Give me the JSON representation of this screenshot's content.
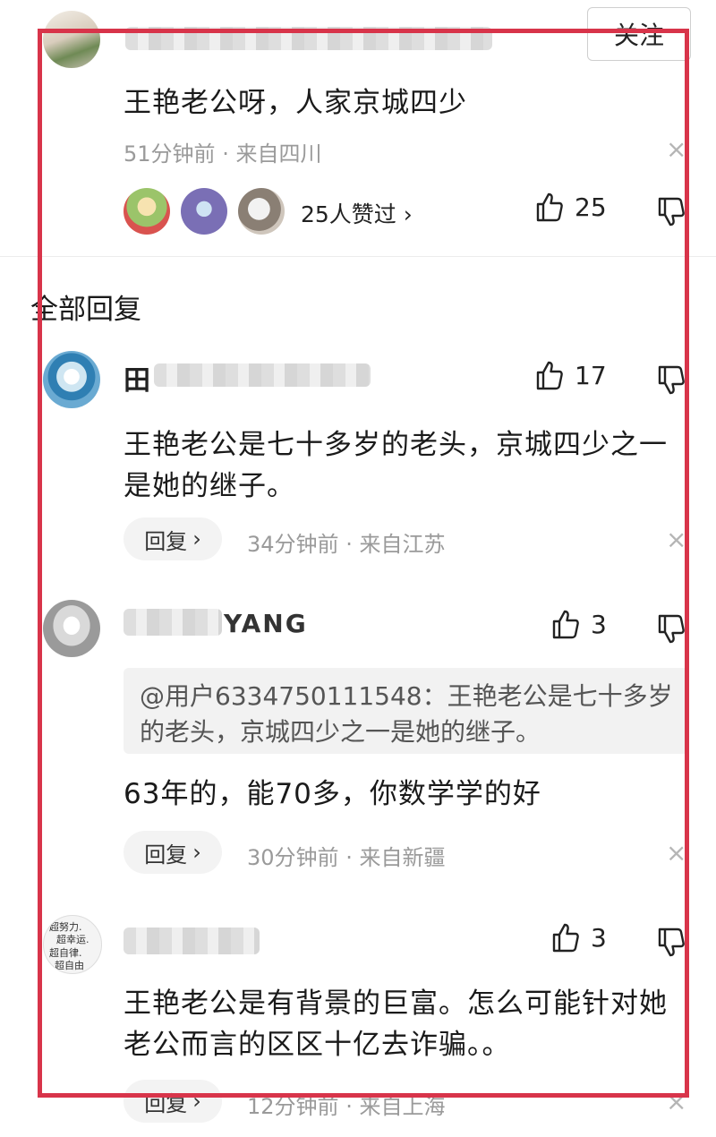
{
  "top_comment": {
    "follow_label": "关注",
    "text": "王艳老公呀，人家京城四少",
    "time": "51分钟前",
    "sep": "·",
    "location": "来自四川",
    "likers_label": "25人赞过",
    "likers_chevron": "›",
    "likes": "25",
    "close": "×"
  },
  "section_title": "全部回复",
  "replies": [
    {
      "name_visible": "田",
      "likes": "17",
      "text": "王艳老公是七十多岁的老头，京城四少之一是她的继子。",
      "reply_label": "回复",
      "chevron": "›",
      "time": "34分钟前",
      "location": "来自江苏",
      "close": "×"
    },
    {
      "name_visible": "YANG",
      "likes": "3",
      "quote": "@用户6334750111548：王艳老公是七十多岁的老头，京城四少之一是她的继子。",
      "text": "63年的，能70多，你数学学的好",
      "reply_label": "回复",
      "chevron": "›",
      "time": "30分钟前",
      "location": "来自新疆",
      "close": "×"
    },
    {
      "likes": "3",
      "text": "王艳老公是有背景的巨富。怎么可能针对她老公而言的区区十亿去诈骗。。",
      "reply_label": "回复",
      "chevron": "›",
      "time": "12分钟前",
      "location": "来自上海",
      "close": "×",
      "avatar_scribble": [
        "超努力.",
        "超幸运.",
        "超自律.",
        "超自由"
      ]
    }
  ],
  "colors": {
    "highlight": "#d8344a",
    "meta": "#9a9a9a"
  },
  "icons": [
    "thumbs-up-icon",
    "thumbs-down-icon",
    "close-icon",
    "chevron-right-icon"
  ]
}
